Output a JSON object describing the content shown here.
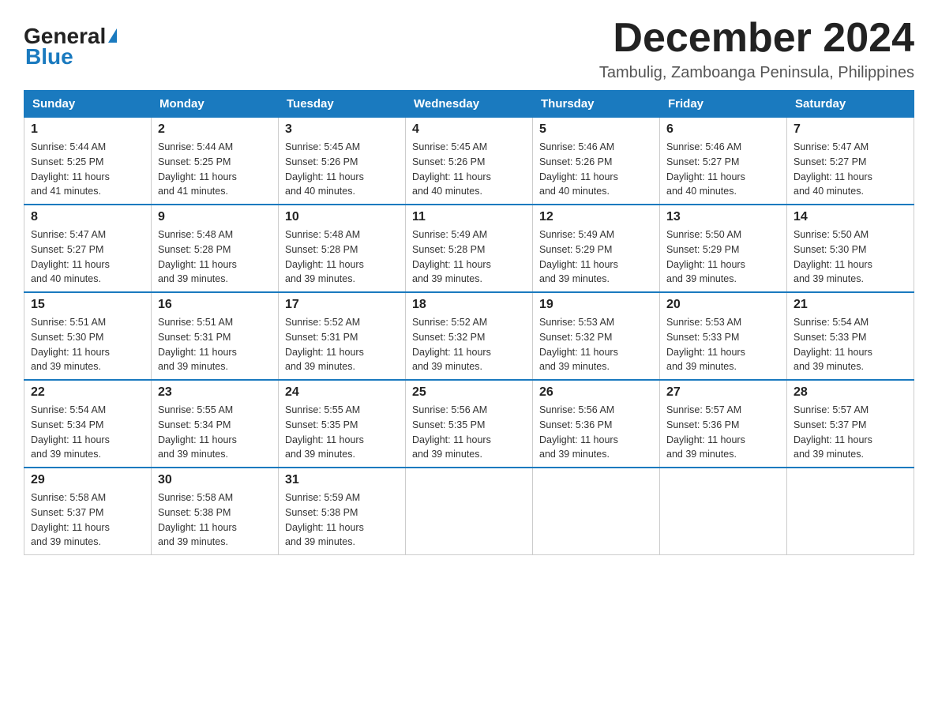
{
  "logo": {
    "general": "General",
    "blue": "Blue",
    "arrow": "▶"
  },
  "header": {
    "month_year": "December 2024",
    "location": "Tambulig, Zamboanga Peninsula, Philippines"
  },
  "days_of_week": [
    "Sunday",
    "Monday",
    "Tuesday",
    "Wednesday",
    "Thursday",
    "Friday",
    "Saturday"
  ],
  "weeks": [
    [
      {
        "day": "1",
        "sunrise": "5:44 AM",
        "sunset": "5:25 PM",
        "daylight": "11 hours and 41 minutes."
      },
      {
        "day": "2",
        "sunrise": "5:44 AM",
        "sunset": "5:25 PM",
        "daylight": "11 hours and 41 minutes."
      },
      {
        "day": "3",
        "sunrise": "5:45 AM",
        "sunset": "5:26 PM",
        "daylight": "11 hours and 40 minutes."
      },
      {
        "day": "4",
        "sunrise": "5:45 AM",
        "sunset": "5:26 PM",
        "daylight": "11 hours and 40 minutes."
      },
      {
        "day": "5",
        "sunrise": "5:46 AM",
        "sunset": "5:26 PM",
        "daylight": "11 hours and 40 minutes."
      },
      {
        "day": "6",
        "sunrise": "5:46 AM",
        "sunset": "5:27 PM",
        "daylight": "11 hours and 40 minutes."
      },
      {
        "day": "7",
        "sunrise": "5:47 AM",
        "sunset": "5:27 PM",
        "daylight": "11 hours and 40 minutes."
      }
    ],
    [
      {
        "day": "8",
        "sunrise": "5:47 AM",
        "sunset": "5:27 PM",
        "daylight": "11 hours and 40 minutes."
      },
      {
        "day": "9",
        "sunrise": "5:48 AM",
        "sunset": "5:28 PM",
        "daylight": "11 hours and 39 minutes."
      },
      {
        "day": "10",
        "sunrise": "5:48 AM",
        "sunset": "5:28 PM",
        "daylight": "11 hours and 39 minutes."
      },
      {
        "day": "11",
        "sunrise": "5:49 AM",
        "sunset": "5:28 PM",
        "daylight": "11 hours and 39 minutes."
      },
      {
        "day": "12",
        "sunrise": "5:49 AM",
        "sunset": "5:29 PM",
        "daylight": "11 hours and 39 minutes."
      },
      {
        "day": "13",
        "sunrise": "5:50 AM",
        "sunset": "5:29 PM",
        "daylight": "11 hours and 39 minutes."
      },
      {
        "day": "14",
        "sunrise": "5:50 AM",
        "sunset": "5:30 PM",
        "daylight": "11 hours and 39 minutes."
      }
    ],
    [
      {
        "day": "15",
        "sunrise": "5:51 AM",
        "sunset": "5:30 PM",
        "daylight": "11 hours and 39 minutes."
      },
      {
        "day": "16",
        "sunrise": "5:51 AM",
        "sunset": "5:31 PM",
        "daylight": "11 hours and 39 minutes."
      },
      {
        "day": "17",
        "sunrise": "5:52 AM",
        "sunset": "5:31 PM",
        "daylight": "11 hours and 39 minutes."
      },
      {
        "day": "18",
        "sunrise": "5:52 AM",
        "sunset": "5:32 PM",
        "daylight": "11 hours and 39 minutes."
      },
      {
        "day": "19",
        "sunrise": "5:53 AM",
        "sunset": "5:32 PM",
        "daylight": "11 hours and 39 minutes."
      },
      {
        "day": "20",
        "sunrise": "5:53 AM",
        "sunset": "5:33 PM",
        "daylight": "11 hours and 39 minutes."
      },
      {
        "day": "21",
        "sunrise": "5:54 AM",
        "sunset": "5:33 PM",
        "daylight": "11 hours and 39 minutes."
      }
    ],
    [
      {
        "day": "22",
        "sunrise": "5:54 AM",
        "sunset": "5:34 PM",
        "daylight": "11 hours and 39 minutes."
      },
      {
        "day": "23",
        "sunrise": "5:55 AM",
        "sunset": "5:34 PM",
        "daylight": "11 hours and 39 minutes."
      },
      {
        "day": "24",
        "sunrise": "5:55 AM",
        "sunset": "5:35 PM",
        "daylight": "11 hours and 39 minutes."
      },
      {
        "day": "25",
        "sunrise": "5:56 AM",
        "sunset": "5:35 PM",
        "daylight": "11 hours and 39 minutes."
      },
      {
        "day": "26",
        "sunrise": "5:56 AM",
        "sunset": "5:36 PM",
        "daylight": "11 hours and 39 minutes."
      },
      {
        "day": "27",
        "sunrise": "5:57 AM",
        "sunset": "5:36 PM",
        "daylight": "11 hours and 39 minutes."
      },
      {
        "day": "28",
        "sunrise": "5:57 AM",
        "sunset": "5:37 PM",
        "daylight": "11 hours and 39 minutes."
      }
    ],
    [
      {
        "day": "29",
        "sunrise": "5:58 AM",
        "sunset": "5:37 PM",
        "daylight": "11 hours and 39 minutes."
      },
      {
        "day": "30",
        "sunrise": "5:58 AM",
        "sunset": "5:38 PM",
        "daylight": "11 hours and 39 minutes."
      },
      {
        "day": "31",
        "sunrise": "5:59 AM",
        "sunset": "5:38 PM",
        "daylight": "11 hours and 39 minutes."
      },
      null,
      null,
      null,
      null
    ]
  ],
  "labels": {
    "sunrise": "Sunrise:",
    "sunset": "Sunset:",
    "daylight": "Daylight:"
  }
}
